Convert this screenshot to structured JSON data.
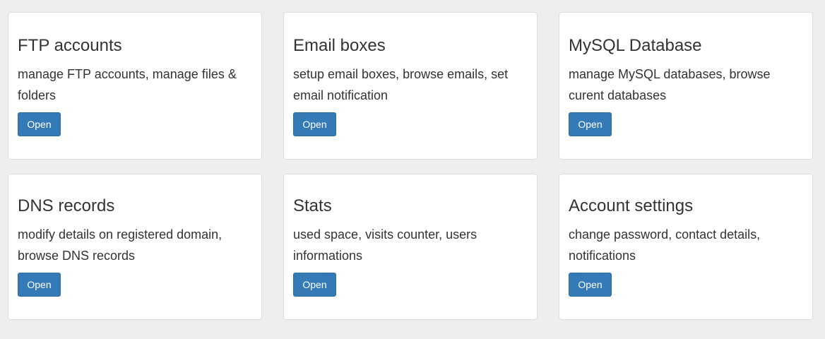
{
  "cards": [
    {
      "title": "FTP accounts",
      "description": "manage FTP accounts, manage files & folders",
      "button_label": "Open"
    },
    {
      "title": "Email boxes",
      "description": "setup email boxes, browse emails, set email notification",
      "button_label": "Open"
    },
    {
      "title": "MySQL Database",
      "description": "manage MySQL databases, browse curent databases",
      "button_label": "Open"
    },
    {
      "title": "DNS records",
      "description": "modify details on registered domain, browse DNS records",
      "button_label": "Open"
    },
    {
      "title": "Stats",
      "description": "used space, visits counter, users informations",
      "button_label": "Open"
    },
    {
      "title": "Account settings",
      "description": "change password, contact details, notifications",
      "button_label": "Open"
    }
  ],
  "colors": {
    "background": "#eeeeee",
    "card_background": "#ffffff",
    "primary_button": "#337ab7",
    "text": "#333333"
  }
}
